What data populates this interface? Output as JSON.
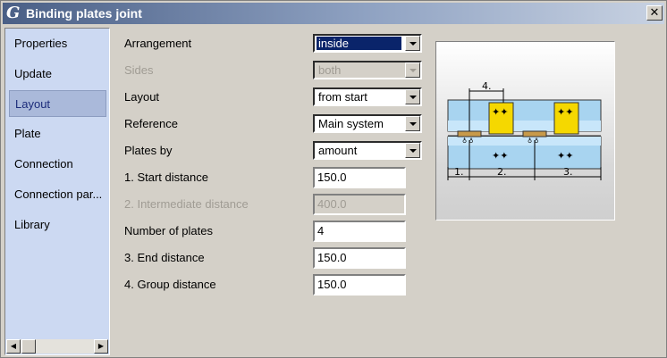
{
  "window": {
    "title": "Binding plates joint",
    "close_glyph": "✕",
    "app_icon_glyph": "G"
  },
  "sidebar": {
    "items": [
      {
        "label": "Properties",
        "selected": false
      },
      {
        "label": "Update",
        "selected": false
      },
      {
        "label": "Layout",
        "selected": true
      },
      {
        "label": "Plate",
        "selected": false
      },
      {
        "label": "Connection",
        "selected": false
      },
      {
        "label": "Connection par...",
        "selected": false
      },
      {
        "label": "Library",
        "selected": false
      }
    ],
    "scroll_left_glyph": "◀",
    "scroll_right_glyph": "▶"
  },
  "form": {
    "arrangement": {
      "label": "Arrangement",
      "value": "inside"
    },
    "sides": {
      "label": "Sides",
      "value": "both",
      "enabled": false
    },
    "layout": {
      "label": "Layout",
      "value": "from start"
    },
    "reference": {
      "label": "Reference",
      "value": "Main system"
    },
    "plates_by": {
      "label": "Plates by",
      "value": "amount"
    },
    "start_distance": {
      "label": "1. Start distance",
      "value": "150.0"
    },
    "intermediate_distance": {
      "label": "2. Intermediate distance",
      "value": "400.0",
      "enabled": false
    },
    "number_of_plates": {
      "label": "Number of plates",
      "value": "4"
    },
    "end_distance": {
      "label": "3. End distance",
      "value": "150.0"
    },
    "group_distance": {
      "label": "4. Group distance",
      "value": "150.0"
    }
  },
  "preview": {
    "dimension_labels": {
      "group": "4.",
      "start": "1.",
      "intermediate": "2.",
      "end": "3."
    },
    "colors": {
      "beam": "#a8d4f0",
      "plate": "#f5d800",
      "bar": "#c89a4a"
    }
  }
}
